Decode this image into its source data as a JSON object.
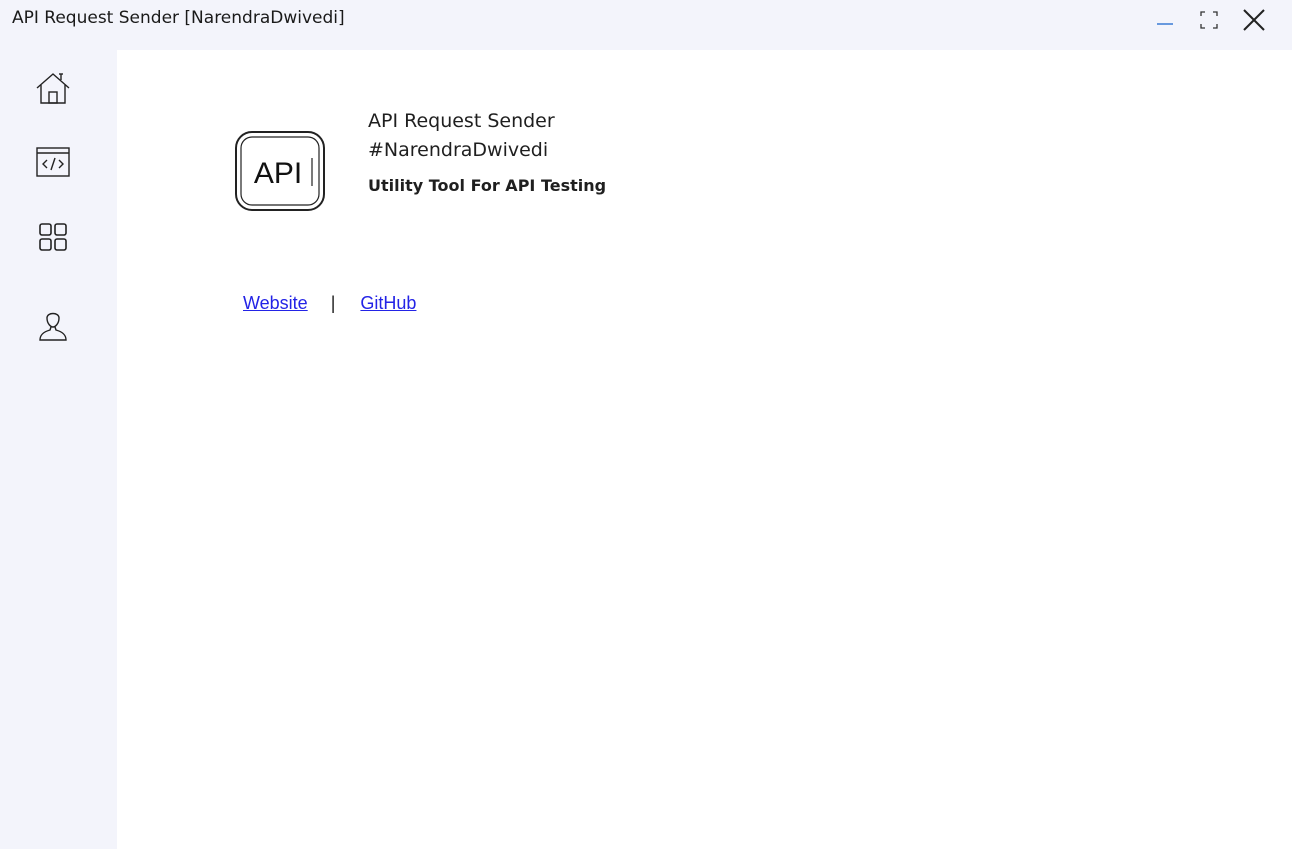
{
  "window": {
    "title": "API Request Sender [NarendraDwivedi]",
    "accent_color": "#3a7bd5"
  },
  "titlebar_controls": {
    "minimize_icon": "minimize-icon",
    "maximize_icon": "maximize-icon",
    "close_icon": "close-icon"
  },
  "sidebar": {
    "items": [
      {
        "id": "home",
        "icon": "home-icon"
      },
      {
        "id": "code",
        "icon": "code-icon"
      },
      {
        "id": "apps",
        "icon": "grid-icon"
      },
      {
        "id": "profile",
        "icon": "user-icon"
      }
    ]
  },
  "about": {
    "logo_text": "API",
    "app_name": "API Request Sender",
    "author": "#NarendraDwivedi",
    "tagline": "Utility Tool For API Testing"
  },
  "links": {
    "website_label": "Website",
    "separator": "|",
    "github_label": "GitHub",
    "link_color": "#2323e6"
  }
}
